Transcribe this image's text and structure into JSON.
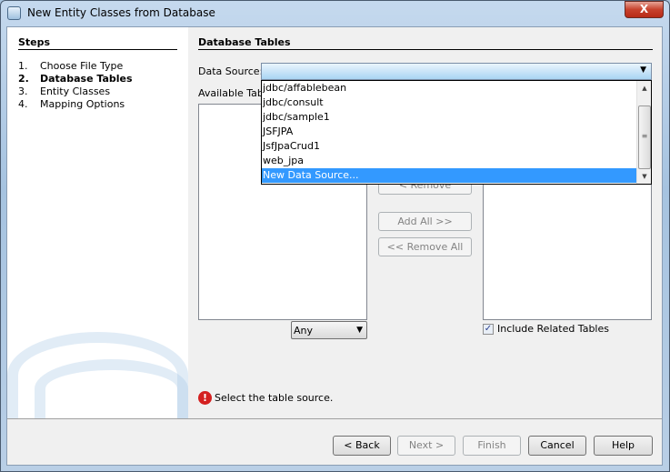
{
  "window": {
    "title": "New Entity Classes from Database",
    "close_label": "X"
  },
  "steps": {
    "heading": "Steps",
    "items": [
      {
        "num": "1.",
        "label": "Choose File Type"
      },
      {
        "num": "2.",
        "label": "Database Tables",
        "current": true
      },
      {
        "num": "3.",
        "label": "Entity Classes"
      },
      {
        "num": "4.",
        "label": "Mapping Options"
      }
    ]
  },
  "main": {
    "heading": "Database Tables",
    "data_source_label": "Data Source:",
    "data_source_value": "",
    "available_label": "Available Tables:",
    "dropdown_options": [
      "jdbc/affablebean",
      "jdbc/consult",
      "jdbc/sample1",
      "JSFJPA",
      "JsfJpaCrud1",
      "web_jpa",
      "New Data Source..."
    ],
    "highlighted_option": "New Data Source...",
    "remove_label": "< Remove",
    "add_all_label": "Add All >>",
    "remove_all_label": "<< Remove All",
    "filter_value": "Any",
    "include_related_label": "Include Related Tables",
    "include_related_checked": true,
    "error_message": "Select the table source."
  },
  "buttons": {
    "back": "< Back",
    "next": "Next >",
    "finish": "Finish",
    "cancel": "Cancel",
    "help": "Help"
  }
}
